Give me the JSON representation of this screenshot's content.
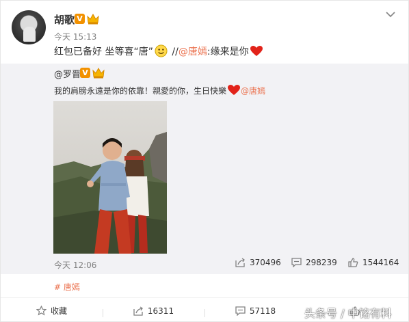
{
  "post": {
    "author": "胡歌",
    "time": "今天 15:13",
    "text_main": "红包已备好 坐等喜“唐”",
    "text_sep": " //",
    "mention": "@唐嫣",
    "text_tail": ":缘来是你",
    "verified_badge": "V"
  },
  "repost": {
    "author": "@罗晋",
    "verified_badge": "V",
    "text": "我的肩膀永遠是你的依靠！親愛的你，生日快樂",
    "mention": "@唐嫣",
    "time": "今天 12:06",
    "shares": "370496",
    "comments": "298239",
    "likes": "1544164"
  },
  "topic": "# 唐嫣",
  "footer": {
    "favorite": "收藏",
    "share": "16311",
    "comment": "57118"
  },
  "watermark": "头条号 / 中铭有料",
  "colors": {
    "link": "#eb7350",
    "badge": "#f29100",
    "repost_bg": "#f2f2f5"
  }
}
